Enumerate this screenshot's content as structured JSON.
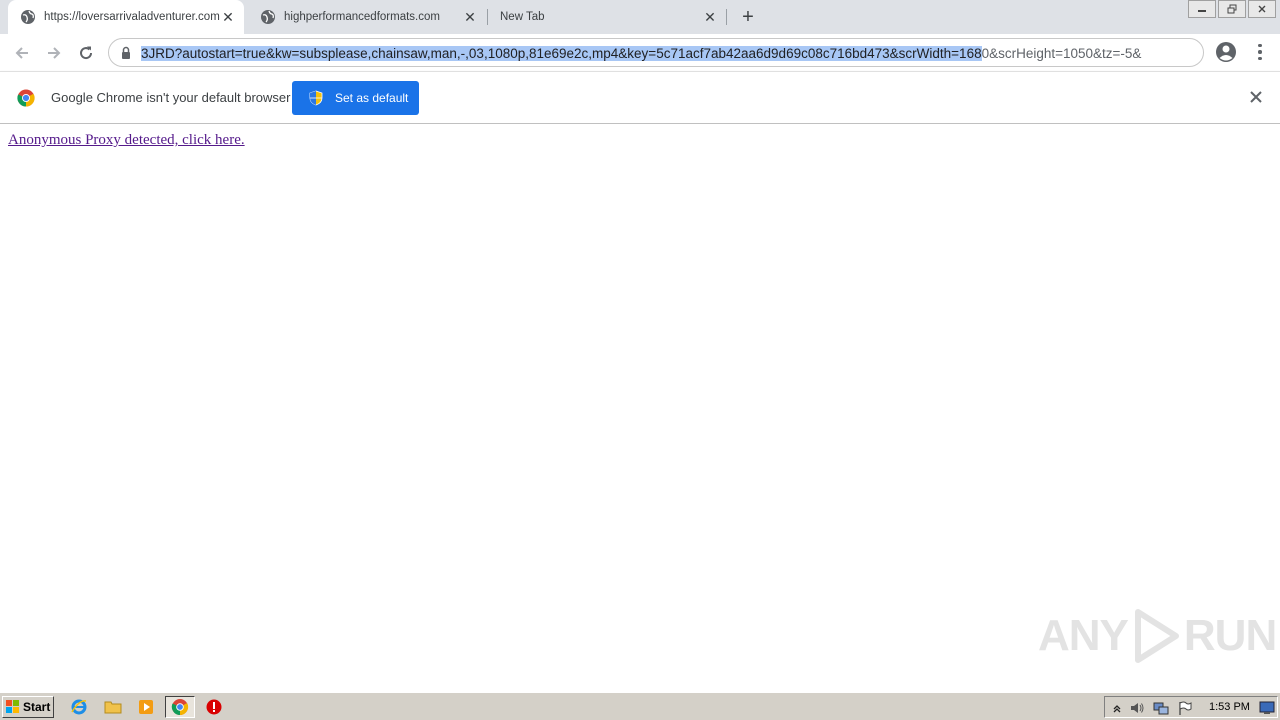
{
  "browser": {
    "tabs": [
      {
        "title": "https://loversarrivaladventurer.com",
        "active": true
      },
      {
        "title": "highperformancedformats.com",
        "active": false
      },
      {
        "title": "New Tab",
        "active": false
      }
    ],
    "newtab_symbol": "+",
    "close_symbol": "✕",
    "omnibox": {
      "url_selected": "3JRD?autostart=true&kw=subsplease,chainsaw,man,-,03,1080p,81e69e2c,mp4&key=5c71acf7ab42aa6d9d69c08c716bd473&scrWidth=168",
      "url_rest": "0&scrHeight=1050&tz=-5&"
    }
  },
  "infobar": {
    "message": "Google Chrome isn't your default browser",
    "button_label": "Set as default"
  },
  "page": {
    "link_text": "Anonymous Proxy detected, click here.",
    "watermark_left": "ANY",
    "watermark_right": "RUN"
  },
  "taskbar": {
    "start_label": "Start",
    "clock": "1:53 PM"
  },
  "colors": {
    "accent": "#1a73e8",
    "link_visited": "#551a8b",
    "selection": "#a8c7f5"
  }
}
